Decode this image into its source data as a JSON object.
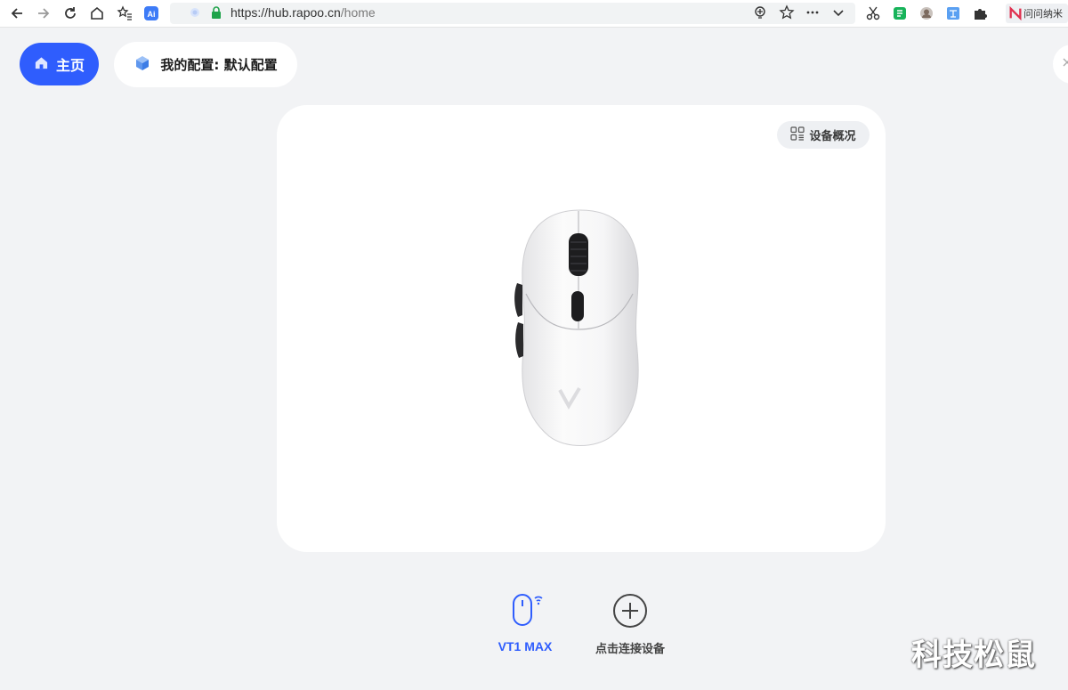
{
  "browser": {
    "url_host": "https://hub.rapoo.cn",
    "url_path": "/home",
    "extension_label": "问问纳米"
  },
  "nav": {
    "home_label": "主页",
    "config_label": "我的配置: 默认配置"
  },
  "device_card": {
    "overview_label": "设备概况"
  },
  "devices": [
    {
      "name": "VT1 MAX"
    },
    {
      "name": "点击连接设备"
    }
  ],
  "watermark": "科技松鼠",
  "colors": {
    "accent": "#2f5dfd",
    "background": "#f2f3f5",
    "card": "#ffffff"
  }
}
